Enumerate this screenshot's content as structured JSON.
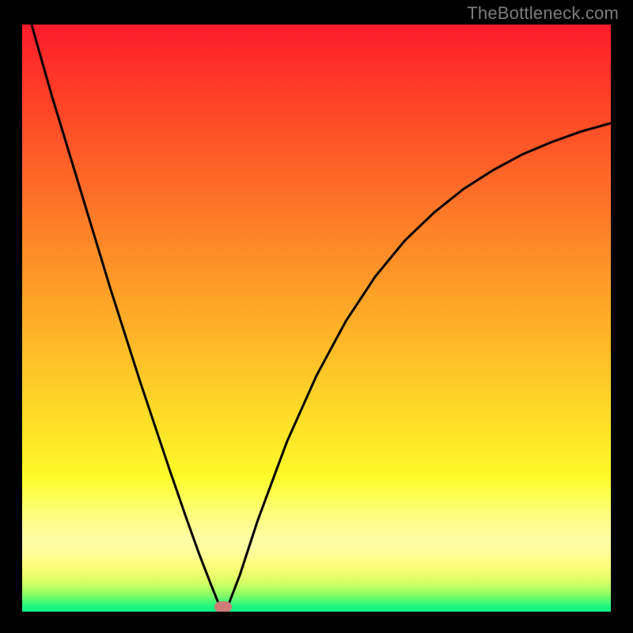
{
  "attribution": "TheBottleneck.com",
  "chart_data": {
    "type": "line",
    "title": "",
    "xlabel": "",
    "ylabel": "",
    "xlim": [
      0,
      100
    ],
    "ylim": [
      0,
      100
    ],
    "grid": false,
    "legend": false,
    "background_gradient": {
      "stops": [
        {
          "offset": 0.0,
          "color": "#fe1c2a"
        },
        {
          "offset": 0.059,
          "color": "#fe2d28"
        },
        {
          "offset": 0.118,
          "color": "#fe3e27"
        },
        {
          "offset": 0.177,
          "color": "#fe4f27"
        },
        {
          "offset": 0.236,
          "color": "#fe6028"
        },
        {
          "offset": 0.295,
          "color": "#fe7128"
        },
        {
          "offset": 0.354,
          "color": "#fe8327"
        },
        {
          "offset": 0.413,
          "color": "#fe9328"
        },
        {
          "offset": 0.472,
          "color": "#fea528"
        },
        {
          "offset": 0.531,
          "color": "#feb627"
        },
        {
          "offset": 0.59,
          "color": "#fec728"
        },
        {
          "offset": 0.649,
          "color": "#fed828"
        },
        {
          "offset": 0.708,
          "color": "#fee928"
        },
        {
          "offset": 0.765,
          "color": "#fef928"
        },
        {
          "offset": 0.77,
          "color": "#fefb2b"
        },
        {
          "offset": 0.8,
          "color": "#fefe52"
        },
        {
          "offset": 0.83,
          "color": "#fefe7b"
        },
        {
          "offset": 0.87,
          "color": "#fefea2"
        },
        {
          "offset": 0.89,
          "color": "#fefea2"
        },
        {
          "offset": 0.92,
          "color": "#fefe79"
        },
        {
          "offset": 0.945,
          "color": "#dbfe65"
        },
        {
          "offset": 0.958,
          "color": "#b4fe64"
        },
        {
          "offset": 0.968,
          "color": "#8bfc65"
        },
        {
          "offset": 0.978,
          "color": "#56fa71"
        },
        {
          "offset": 0.988,
          "color": "#1ff680"
        },
        {
          "offset": 1.0,
          "color": "#08f286"
        }
      ]
    },
    "series": [
      {
        "name": "bottleneck-curve",
        "stroke": "#000000",
        "stroke_width": 3,
        "points": [
          {
            "x": 1.6,
            "y": 100.0
          },
          {
            "x": 5.0,
            "y": 88.0
          },
          {
            "x": 10.0,
            "y": 71.5
          },
          {
            "x": 15.0,
            "y": 55.0
          },
          {
            "x": 20.0,
            "y": 39.3
          },
          {
            "x": 25.0,
            "y": 24.3
          },
          {
            "x": 28.0,
            "y": 15.6
          },
          {
            "x": 30.0,
            "y": 10.0
          },
          {
            "x": 32.0,
            "y": 4.8
          },
          {
            "x": 33.6,
            "y": 0.8
          },
          {
            "x": 34.9,
            "y": 0.8
          },
          {
            "x": 37.0,
            "y": 6.3
          },
          {
            "x": 40.0,
            "y": 15.5
          },
          {
            "x": 45.0,
            "y": 29.0
          },
          {
            "x": 50.0,
            "y": 40.2
          },
          {
            "x": 55.0,
            "y": 49.5
          },
          {
            "x": 60.0,
            "y": 57.1
          },
          {
            "x": 65.0,
            "y": 63.2
          },
          {
            "x": 70.0,
            "y": 68.0
          },
          {
            "x": 75.0,
            "y": 72.0
          },
          {
            "x": 80.0,
            "y": 75.2
          },
          {
            "x": 85.0,
            "y": 77.9
          },
          {
            "x": 90.0,
            "y": 80.0
          },
          {
            "x": 95.0,
            "y": 81.8
          },
          {
            "x": 100.0,
            "y": 83.2
          }
        ]
      }
    ],
    "marker": {
      "name": "optimal-point",
      "x": 34.2,
      "y": 0.8,
      "color": "#cf7b78"
    }
  }
}
